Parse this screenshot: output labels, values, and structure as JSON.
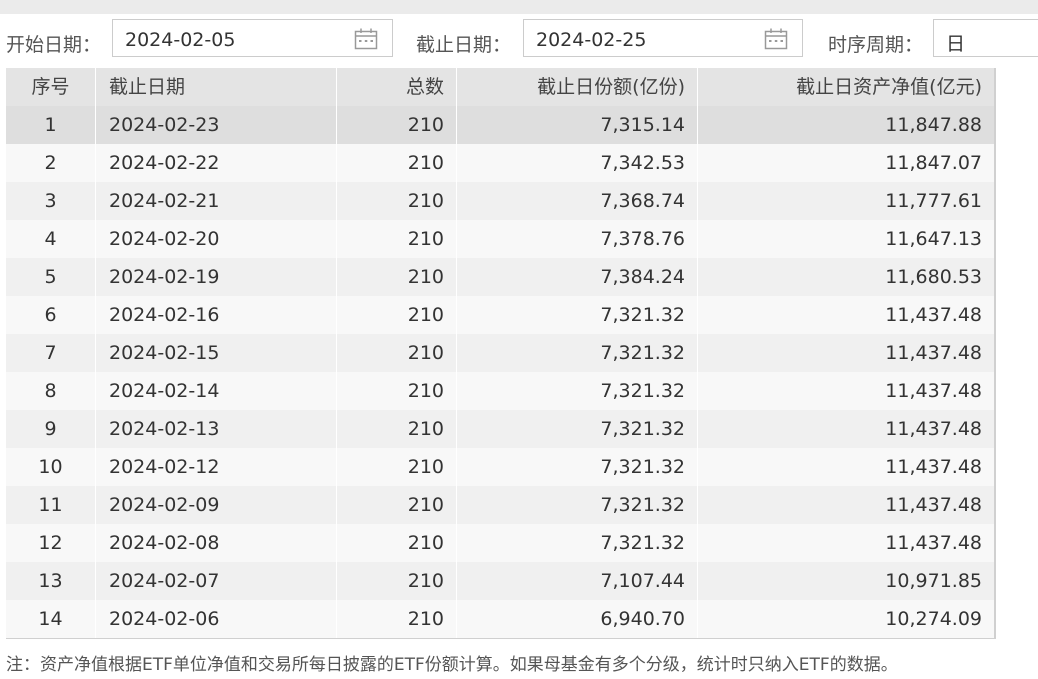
{
  "filters": {
    "start_label": "开始日期：",
    "start_value": "2024-02-05",
    "end_label": "截止日期：",
    "end_value": "2024-02-25",
    "period_label": "时序周期：",
    "period_value": "日",
    "calendar_icon": "calendar-icon"
  },
  "table": {
    "headers": [
      "序号",
      "截止日期",
      "总数",
      "截止日份额(亿份)",
      "截止日资产净值(亿元)"
    ],
    "rows": [
      [
        "1",
        "2024-02-23",
        "210",
        "7,315.14",
        "11,847.88"
      ],
      [
        "2",
        "2024-02-22",
        "210",
        "7,342.53",
        "11,847.07"
      ],
      [
        "3",
        "2024-02-21",
        "210",
        "7,368.74",
        "11,777.61"
      ],
      [
        "4",
        "2024-02-20",
        "210",
        "7,378.76",
        "11,647.13"
      ],
      [
        "5",
        "2024-02-19",
        "210",
        "7,384.24",
        "11,680.53"
      ],
      [
        "6",
        "2024-02-16",
        "210",
        "7,321.32",
        "11,437.48"
      ],
      [
        "7",
        "2024-02-15",
        "210",
        "7,321.32",
        "11,437.48"
      ],
      [
        "8",
        "2024-02-14",
        "210",
        "7,321.32",
        "11,437.48"
      ],
      [
        "9",
        "2024-02-13",
        "210",
        "7,321.32",
        "11,437.48"
      ],
      [
        "10",
        "2024-02-12",
        "210",
        "7,321.32",
        "11,437.48"
      ],
      [
        "11",
        "2024-02-09",
        "210",
        "7,321.32",
        "11,437.48"
      ],
      [
        "12",
        "2024-02-08",
        "210",
        "7,321.32",
        "11,437.48"
      ],
      [
        "13",
        "2024-02-07",
        "210",
        "7,107.44",
        "10,971.85"
      ],
      [
        "14",
        "2024-02-06",
        "210",
        "6,940.70",
        "10,274.09"
      ]
    ]
  },
  "note": "注：资产净值根据ETF单位净值和交易所每日披露的ETF份额计算。如果母基金有多个分级，统计时只纳入ETF的数据。"
}
